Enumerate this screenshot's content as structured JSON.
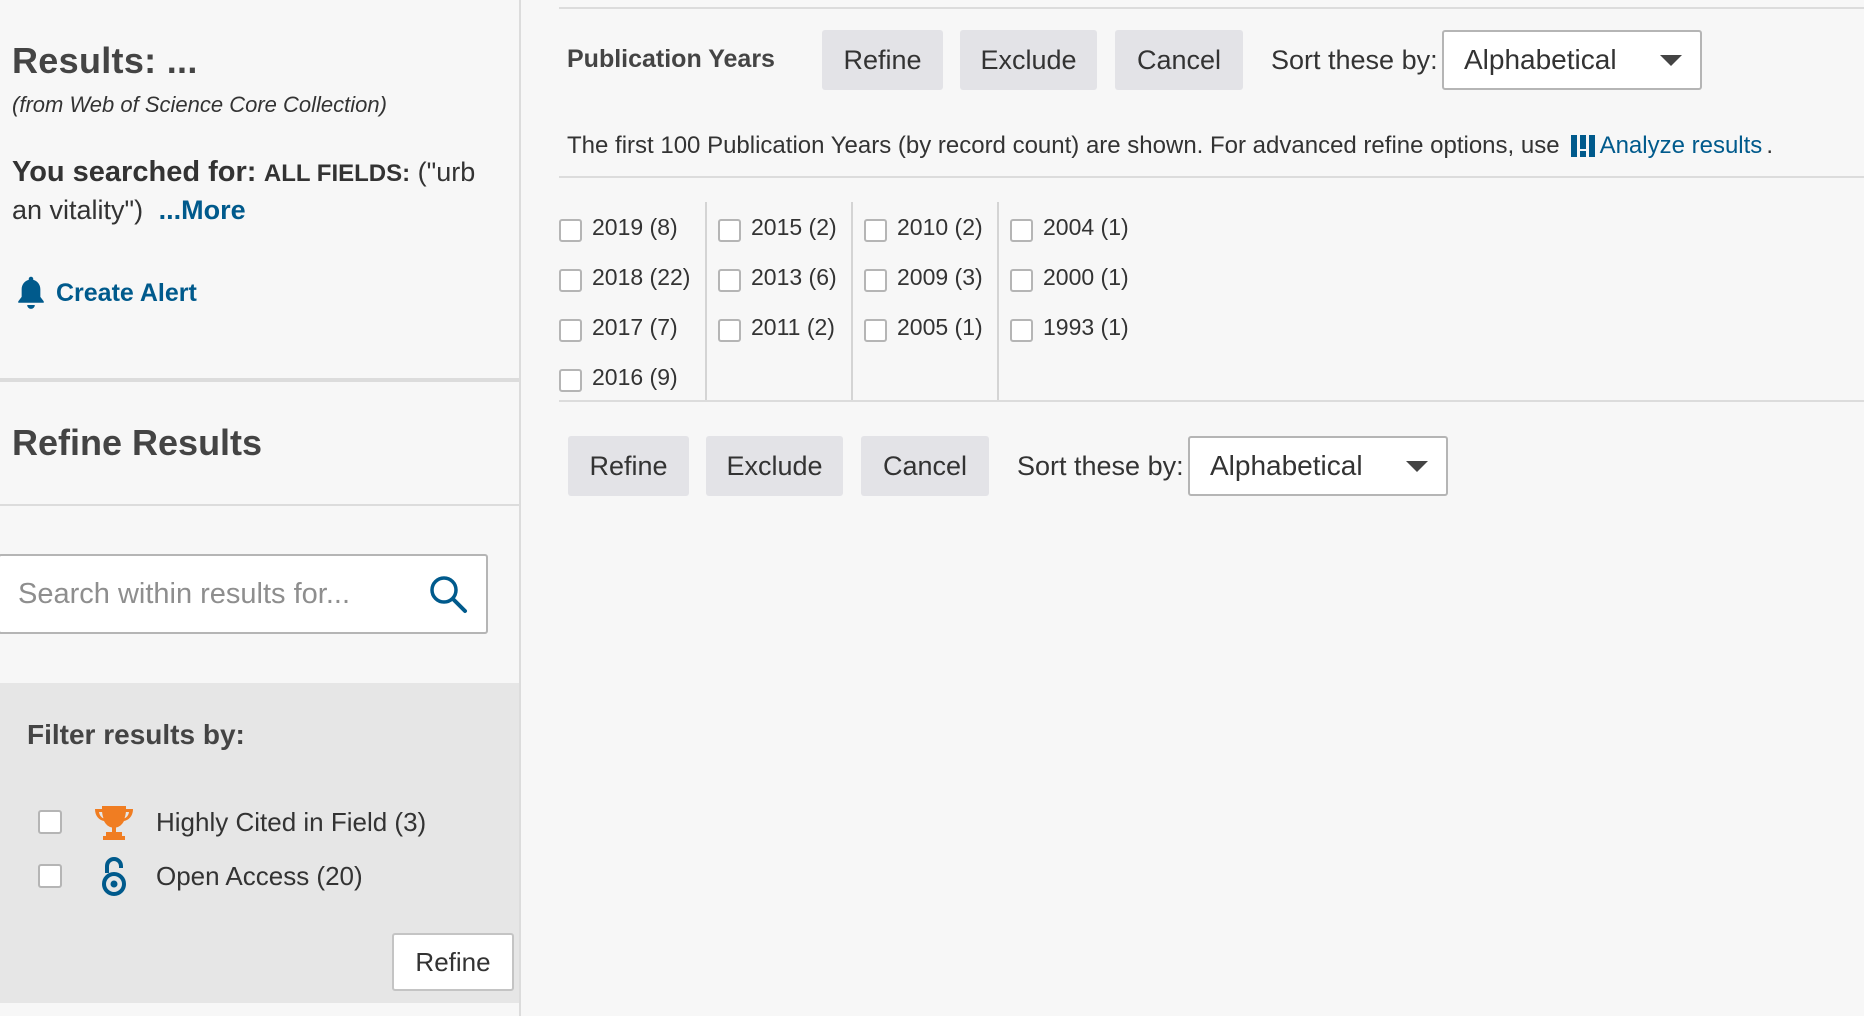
{
  "sidebar": {
    "results_title": "Results: ...",
    "results_source": "(from Web of Science Core Collection)",
    "searched_label": "You searched for:",
    "searched_field": "ALL FIELDS:",
    "searched_query_line1": "(\"urb",
    "searched_query_line2": "an vitality\")",
    "more_link": "...More",
    "create_alert": "Create Alert",
    "refine_title": "Refine Results",
    "search_placeholder": "Search within results for...",
    "filter_title": "Filter results by:",
    "filters": [
      {
        "label": "Highly Cited in Field (3)",
        "icon": "trophy-icon",
        "color": "#f07d22"
      },
      {
        "label": "Open Access (20)",
        "icon": "open-access-icon",
        "color": "#005a8c"
      }
    ],
    "refine_button": "Refine"
  },
  "main": {
    "section_label": "Publication Years",
    "buttons": {
      "refine": "Refine",
      "exclude": "Exclude",
      "cancel": "Cancel"
    },
    "sort_label": "Sort these by:",
    "sort_value": "Alphabetical",
    "info_text": "The first 100 Publication Years (by record count) are shown. For advanced refine options, use",
    "analyze_link": "Analyze results",
    "info_suffix": ".",
    "years": [
      [
        "2019 (8)",
        "2018 (22)",
        "2017 (7)",
        "2016 (9)"
      ],
      [
        "2015 (2)",
        "2013 (6)",
        "2011 (2)"
      ],
      [
        "2010 (2)",
        "2009 (3)",
        "2005 (1)"
      ],
      [
        "2004 (1)",
        "2000 (1)",
        "1993 (1)"
      ]
    ]
  },
  "colors": {
    "link": "#005a8c",
    "button_bg": "#e3e3e7",
    "filter_panel_bg": "#e6e6e6",
    "trophy": "#f07d22"
  }
}
